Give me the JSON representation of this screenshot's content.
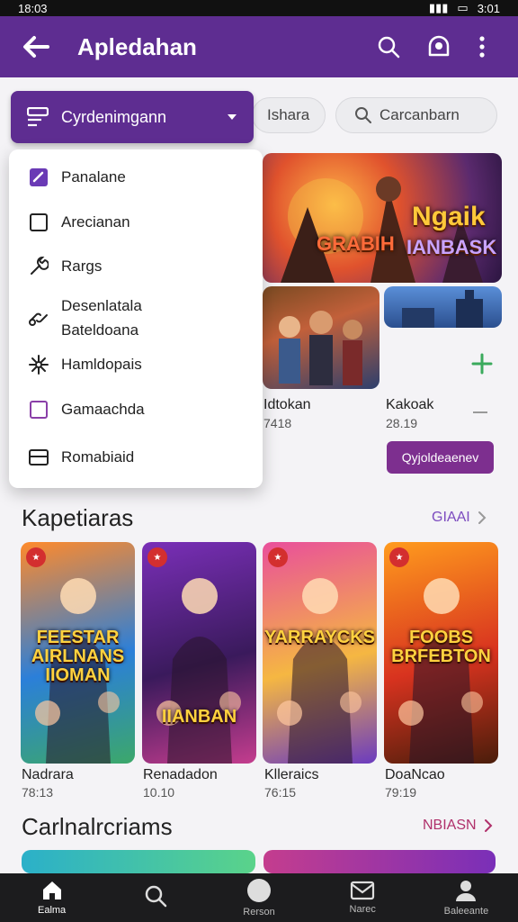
{
  "status_bar": {
    "time_left": "18:03",
    "time_right": "3:01"
  },
  "app_bar": {
    "title": "Apledahan"
  },
  "chips": [
    {
      "label": "Ishara"
    },
    {
      "label": "Carcanbarn"
    }
  ],
  "dropdown": {
    "selected": "Cyrdenimgann",
    "items": [
      {
        "label": "Panalane",
        "icon": "checked-box-icon"
      },
      {
        "label": "Arecianan",
        "icon": "empty-box-icon"
      },
      {
        "label": "Rargs",
        "icon": "wrench-icon"
      },
      {
        "label": "Desenlatala\nBateldoana",
        "icon": "link-icon"
      },
      {
        "label": "Hamldopais",
        "icon": "sparkle-icon"
      },
      {
        "label": "Gamaachda",
        "icon": "purple-box-icon"
      },
      {
        "label": "Romabiaid",
        "icon": "card-icon"
      }
    ]
  },
  "featured": {
    "hero_title_1": "Ngaik",
    "hero_title_2": "GRABIH",
    "hero_title_3": "IANBASK",
    "items": [
      {
        "name": "Idtokan",
        "count": "7418"
      },
      {
        "name": "Kakoak",
        "count": "28.19"
      }
    ],
    "action_button": "Qyjoldeaenev"
  },
  "section1": {
    "title": "Kapetiaras",
    "link": "GIAAI",
    "games": [
      {
        "name": "Nadrara",
        "count": "78:13",
        "poster": "FEESTAR AIRLNANS IIOMAN",
        "colors": [
          "#ff8a2b",
          "#2b7fd9",
          "#3ca86a"
        ]
      },
      {
        "name": "Renadadon",
        "count": "10.10",
        "poster": "IIANBAN",
        "colors": [
          "#7a2fb8",
          "#3a1a5c",
          "#c43d8e"
        ]
      },
      {
        "name": "Klleraics",
        "count": "76:15",
        "poster": "YARRAYCKS",
        "colors": [
          "#e94f9b",
          "#f5b742",
          "#6b3bbf"
        ]
      },
      {
        "name": "DoaNcao",
        "count": "79:19",
        "poster": "FOOBS BRFEBTON",
        "colors": [
          "#ff9b1e",
          "#d8331f",
          "#4a1d0b"
        ]
      }
    ]
  },
  "section2": {
    "title": "Carlnalrcriams",
    "link": "NBIASN"
  },
  "bottom_nav": [
    {
      "label": "Ealma",
      "icon": "home-icon"
    },
    {
      "label": "",
      "icon": "search-icon"
    },
    {
      "label": "Rerson",
      "icon": "circle-icon"
    },
    {
      "label": "Narec",
      "icon": "mail-icon"
    },
    {
      "label": "Baleeante",
      "icon": "profile-icon"
    }
  ],
  "colors": {
    "primary": "#5e2d91",
    "accent": "#7d2f8f",
    "link_pink": "#b0306b",
    "link_purple": "#7c4bbf",
    "plus_green": "#3aaa5c"
  }
}
